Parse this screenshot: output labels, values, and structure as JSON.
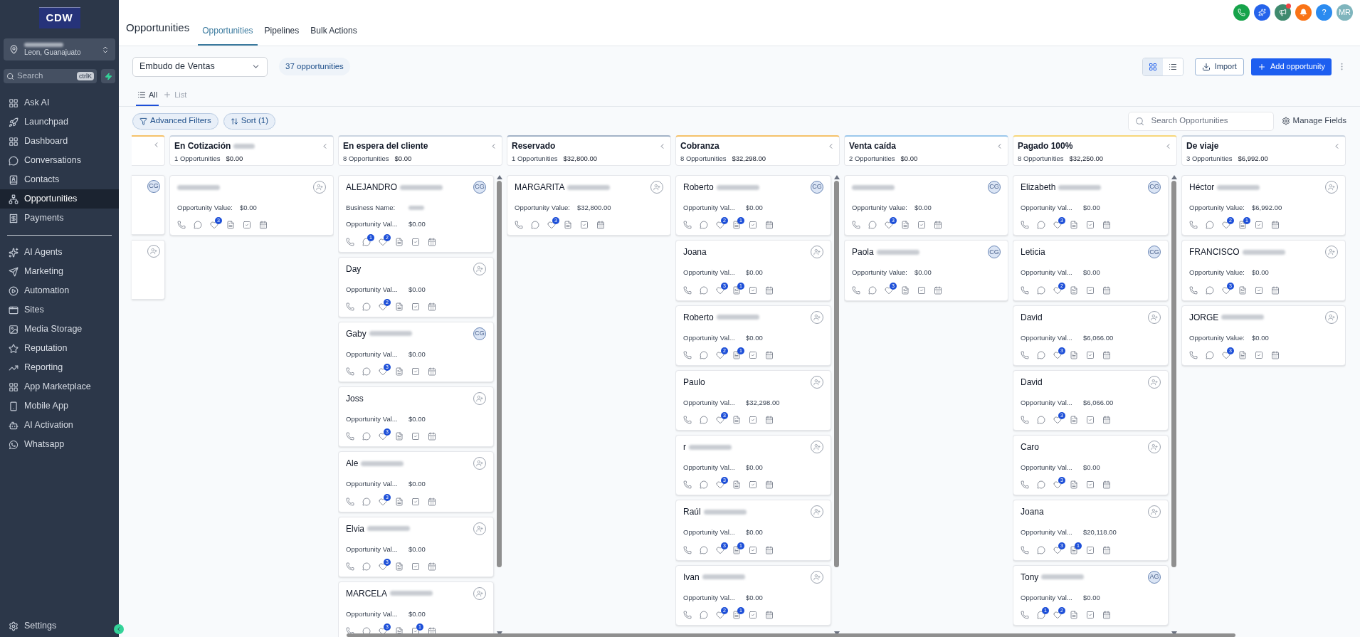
{
  "sidebar": {
    "logo": "CDW",
    "account": {
      "location": "Leon, Guanajuato"
    },
    "search": {
      "placeholder": "Search",
      "shortcut": "ctrlK"
    },
    "items": [
      {
        "label": "Ask AI",
        "selected": false
      },
      {
        "label": "Launchpad",
        "selected": false
      },
      {
        "label": "Dashboard",
        "selected": false
      },
      {
        "label": "Conversations",
        "selected": false
      },
      {
        "label": "Contacts",
        "selected": false
      },
      {
        "label": "Opportunities",
        "selected": true
      },
      {
        "label": "Payments",
        "selected": false
      }
    ],
    "items_2": [
      {
        "label": "AI Agents",
        "selected": false
      },
      {
        "label": "Marketing",
        "selected": false
      },
      {
        "label": "Automation",
        "selected": false
      },
      {
        "label": "Sites",
        "selected": false
      },
      {
        "label": "Media Storage",
        "selected": false
      },
      {
        "label": "Reputation",
        "selected": false
      },
      {
        "label": "Reporting",
        "selected": false
      },
      {
        "label": "App Marketplace",
        "selected": false
      },
      {
        "label": "Mobile App",
        "selected": false
      },
      {
        "label": "AI Activation",
        "selected": false
      },
      {
        "label": "Whatsapp",
        "selected": false
      }
    ],
    "settings": "Settings"
  },
  "header": {
    "title": "Opportunities",
    "tabs": [
      {
        "label": "Opportunities",
        "selected": true
      },
      {
        "label": "Pipelines",
        "selected": false
      },
      {
        "label": "Bulk Actions",
        "selected": false
      }
    ],
    "help": "?",
    "user_initials": "MR"
  },
  "toolbar": {
    "pipeline": "Embudo de Ventas",
    "count": "37 opportunities",
    "import": "Import",
    "add": "Add opportunity"
  },
  "views": [
    {
      "label": "All",
      "selected": true
    },
    {
      "label": "List",
      "selected": false
    }
  ],
  "filters": {
    "advanced": "Advanced Filters",
    "sort": "Sort (1)",
    "search_placeholder": "Search Opportunities",
    "manage": "Manage Fields"
  },
  "columns": [
    {
      "partial": true,
      "color": "#f5c26b",
      "cards": [
        {
          "assigned": true,
          "assignee": "CG"
        },
        {
          "assigned": false
        }
      ]
    },
    {
      "title": "En Cotización",
      "redacted": true,
      "count": "1 Opportunities",
      "total": "$0.00",
      "color": "#cbd5e1",
      "cards": [
        {
          "redacted": true,
          "assigned": false,
          "fields": [
            {
              "label": "Opportunity Value:",
              "value": "$0.00"
            }
          ],
          "tag_count": "3"
        }
      ]
    },
    {
      "title": "En espera del cliente",
      "redacted": false,
      "count": "8 Opportunities",
      "total": "$0.00",
      "color": "#cbd5e1",
      "cards": [
        {
          "name": "ALEJANDRO",
          "redacted": true,
          "assigned": true,
          "assignee": "CG",
          "fields": [
            {
              "label": "Business Name:",
              "redacted": true
            },
            {
              "label": "Opportunity Val...",
              "value": "$0.00"
            }
          ],
          "chat_count": "1",
          "tag_count": "2"
        },
        {
          "name": "Day",
          "redacted": false,
          "assigned": false,
          "fields": [
            {
              "label": "Opportunity Val...",
              "value": "$0.00"
            }
          ],
          "tag_count": "2"
        },
        {
          "name": "Gaby",
          "redacted": true,
          "assigned": true,
          "assignee": "CG",
          "fields": [
            {
              "label": "Opportunity Val...",
              "value": "$0.00"
            }
          ],
          "tag_count": "3"
        },
        {
          "name": "Joss",
          "redacted": false,
          "assigned": false,
          "fields": [
            {
              "label": "Opportunity Val...",
              "value": "$0.00"
            }
          ],
          "tag_count": "3"
        },
        {
          "name": "Ale",
          "redacted": true,
          "assigned": false,
          "fields": [
            {
              "label": "Opportunity Val...",
              "value": "$0.00"
            }
          ],
          "tag_count": "3"
        },
        {
          "name": "Elvia",
          "redacted": true,
          "assigned": false,
          "fields": [
            {
              "label": "Opportunity Val...",
              "value": "$0.00"
            }
          ],
          "tag_count": "3"
        },
        {
          "name": "MARCELA",
          "redacted": true,
          "assigned": false,
          "fields": [
            {
              "label": "Opportunity Val...",
              "value": "$0.00"
            }
          ],
          "tag_count": "3",
          "task_count": "1"
        }
      ]
    },
    {
      "title": "Reservado",
      "redacted": false,
      "count": "1 Opportunities",
      "total": "$32,800.00",
      "color": "#a3b3c7",
      "cards": [
        {
          "name": "MARGARITA",
          "redacted": true,
          "assigned": false,
          "fields": [
            {
              "label": "Opportunity Value:",
              "value": "$32,800.00"
            }
          ],
          "tag_count": "3"
        }
      ]
    },
    {
      "title": "Cobranza",
      "redacted": false,
      "count": "8 Opportunities",
      "total": "$32,298.00",
      "color": "#f5c26b",
      "cards": [
        {
          "name": "Roberto",
          "redacted": true,
          "assigned": true,
          "assignee": "CG",
          "fields": [
            {
              "label": "Opportunity Val...",
              "value": "$0.00"
            }
          ],
          "tag_count": "2",
          "note_count": "1"
        },
        {
          "name": "Joana",
          "redacted": false,
          "assigned": false,
          "fields": [
            {
              "label": "Opportunity Val...",
              "value": "$0.00"
            }
          ],
          "tag_count": "3",
          "note_count": "1"
        },
        {
          "name": "Roberto",
          "redacted": true,
          "assigned": false,
          "fields": [
            {
              "label": "Opportunity Val...",
              "value": "$0.00"
            }
          ],
          "tag_count": "2",
          "note_count": "1"
        },
        {
          "name": "Paulo",
          "redacted": false,
          "assigned": false,
          "fields": [
            {
              "label": "Opportunity Val...",
              "value": "$32,298.00"
            }
          ],
          "tag_count": "3"
        },
        {
          "name": "r",
          "redacted": true,
          "assigned": false,
          "fields": [
            {
              "label": "Opportunity Val...",
              "value": "$0.00"
            }
          ],
          "tag_count": "3"
        },
        {
          "name": "Raúl",
          "redacted": true,
          "assigned": false,
          "fields": [
            {
              "label": "Opportunity Val...",
              "value": "$0.00"
            }
          ],
          "tag_count": "3",
          "note_count": "1"
        },
        {
          "name": "Ivan",
          "redacted": true,
          "assigned": false,
          "fields": [
            {
              "label": "Opportunity Val...",
              "value": "$0.00"
            }
          ],
          "tag_count": "2",
          "note_count": "1"
        }
      ]
    },
    {
      "title": "Venta caída",
      "redacted": false,
      "count": "2 Opportunities",
      "total": "$0.00",
      "color": "#9cc8ec",
      "cards": [
        {
          "redacted": true,
          "assigned": true,
          "assignee": "CG",
          "fields": [
            {
              "label": "Opportunity Value:",
              "value": "$0.00"
            }
          ],
          "tag_count": "3"
        },
        {
          "name": "Paola",
          "redacted": true,
          "assigned": true,
          "assignee": "CG",
          "fields": [
            {
              "label": "Opportunity Value:",
              "value": "$0.00"
            }
          ],
          "tag_count": "3"
        }
      ]
    },
    {
      "title": "Pagado 100%",
      "redacted": false,
      "count": "8 Opportunities",
      "total": "$32,250.00",
      "color": "#f7d77a",
      "cards": [
        {
          "name": "Elizabeth",
          "redacted": true,
          "assigned": true,
          "assignee": "CG",
          "fields": [
            {
              "label": "Opportunity Val...",
              "value": "$0.00"
            }
          ],
          "tag_count": "3"
        },
        {
          "name": "Leticia",
          "redacted": false,
          "assigned": true,
          "assignee": "CG",
          "fields": [
            {
              "label": "Opportunity Val...",
              "value": "$0.00"
            }
          ],
          "tag_count": "2"
        },
        {
          "name": "David",
          "redacted": false,
          "assigned": false,
          "fields": [
            {
              "label": "Opportunity Val...",
              "value": "$6,066.00"
            }
          ],
          "tag_count": "3"
        },
        {
          "name": "David",
          "redacted": false,
          "assigned": false,
          "fields": [
            {
              "label": "Opportunity Val...",
              "value": "$6,066.00"
            }
          ],
          "tag_count": "3"
        },
        {
          "name": "Caro",
          "redacted": false,
          "assigned": false,
          "fields": [
            {
              "label": "Opportunity Val...",
              "value": "$0.00"
            }
          ],
          "tag_count": "3"
        },
        {
          "name": "Joana",
          "redacted": false,
          "assigned": false,
          "fields": [
            {
              "label": "Opportunity Val...",
              "value": "$20,118.00"
            }
          ],
          "tag_count": "3",
          "note_count": "1"
        },
        {
          "name": "Tony",
          "redacted": true,
          "assigned": true,
          "assignee": "AG",
          "fields": [
            {
              "label": "Opportunity Val...",
              "value": "$0.00"
            }
          ],
          "chat_count": "1",
          "tag_count": "2"
        }
      ]
    },
    {
      "title": "De viaje",
      "redacted": false,
      "count": "3 Opportunities",
      "total": "$6,992.00",
      "color": "#cbd5e1",
      "cards": [
        {
          "name": "Héctor",
          "redacted": true,
          "assigned": false,
          "fields": [
            {
              "label": "Opportunity Value:",
              "value": "$6,992.00"
            }
          ],
          "tag_count": "2",
          "note_count": "1"
        },
        {
          "name": "FRANCISCO",
          "redacted": true,
          "assigned": false,
          "fields": [
            {
              "label": "Opportunity Value:",
              "value": "$0.00"
            }
          ],
          "tag_count": "3"
        },
        {
          "name": "JORGE",
          "redacted": true,
          "assigned": false,
          "fields": [
            {
              "label": "Opportunity Value:",
              "value": "$0.00"
            }
          ],
          "tag_count": "3"
        }
      ]
    }
  ]
}
